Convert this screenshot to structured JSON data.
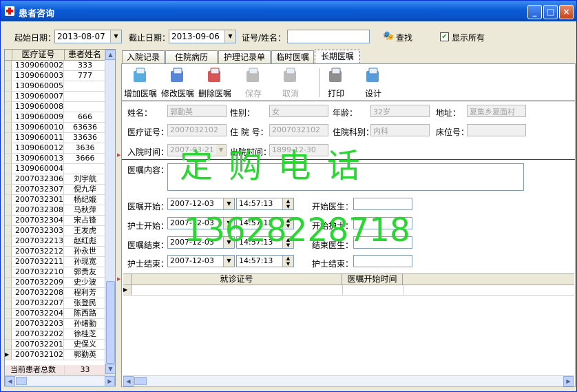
{
  "window": {
    "title": "患者咨询",
    "minimize": "_",
    "maximize": "□",
    "close": "×"
  },
  "filter": {
    "start_label": "起始日期：",
    "start_value": "2013-08-07",
    "end_label": "截止日期：",
    "end_value": "2013-09-06",
    "id_label": "证号/姓名：",
    "id_value": "",
    "search_label": "查找",
    "show_all_label": "显示所有",
    "show_all_checked": true
  },
  "patient_list": {
    "columns": [
      "医疗证号",
      "患者姓名"
    ],
    "rows": [
      {
        "id": "1309060002",
        "name": "333"
      },
      {
        "id": "1309060003",
        "name": "777"
      },
      {
        "id": "1309060005",
        "name": ""
      },
      {
        "id": "1309060007",
        "name": ""
      },
      {
        "id": "1309060008",
        "name": ""
      },
      {
        "id": "1309060009",
        "name": "666"
      },
      {
        "id": "1309060010",
        "name": "63636"
      },
      {
        "id": "1309060011",
        "name": "33636"
      },
      {
        "id": "1309060012",
        "name": "3636"
      },
      {
        "id": "1309060013",
        "name": "3666"
      },
      {
        "id": "1309060004",
        "name": ""
      },
      {
        "id": "2007032306",
        "name": "刘宇航"
      },
      {
        "id": "2007032307",
        "name": "倪九华"
      },
      {
        "id": "2007032301",
        "name": "杨纪娥"
      },
      {
        "id": "2007032308",
        "name": "马秋萍"
      },
      {
        "id": "2007032304",
        "name": "宋占锋"
      },
      {
        "id": "2007032303",
        "name": "王发虎"
      },
      {
        "id": "2007032213",
        "name": "赵红彪"
      },
      {
        "id": "2007032212",
        "name": "孙永世"
      },
      {
        "id": "2007032211",
        "name": "孙现宽"
      },
      {
        "id": "2007032210",
        "name": "郭贵友"
      },
      {
        "id": "2007032209",
        "name": "史少波"
      },
      {
        "id": "2007032208",
        "name": "程利芳"
      },
      {
        "id": "2007032207",
        "name": "张登民"
      },
      {
        "id": "2007032204",
        "name": "陈西路"
      },
      {
        "id": "2007032203",
        "name": "孙绪勤"
      },
      {
        "id": "2007032202",
        "name": "徐桂芝"
      },
      {
        "id": "2007032201",
        "name": "史保义"
      },
      {
        "id": "2007032102",
        "name": "郭勤英"
      }
    ],
    "selected_index": 28,
    "total_label": "当前患者总数",
    "total_value": "33"
  },
  "tabs": [
    "入院记录",
    "住院病历",
    "护理记录单",
    "临时医嘱",
    "长期医嘱"
  ],
  "active_tab": 4,
  "tools": [
    {
      "label": "增加医嘱",
      "icon": "add-order-icon",
      "enabled": true
    },
    {
      "label": "修改医嘱",
      "icon": "edit-order-icon",
      "enabled": true
    },
    {
      "label": "删除医嘱",
      "icon": "delete-order-icon",
      "enabled": true
    },
    {
      "label": "保存",
      "icon": "save-icon",
      "enabled": false
    },
    {
      "label": "取消",
      "icon": "cancel-icon",
      "enabled": false
    },
    {
      "label": "打印",
      "icon": "printer-icon",
      "enabled": true
    },
    {
      "label": "设计",
      "icon": "design-icon",
      "enabled": true
    }
  ],
  "patient_info": {
    "name_label": "姓名：",
    "name_value": "郭勤英",
    "sex_label": "性别：",
    "sex_value": "女",
    "age_label": "年龄：",
    "age_value": "32岁",
    "address_label": "地址：",
    "address_value": "夏集乡夏面村",
    "med_id_label": "医疗证号：",
    "med_id_value": "2007032102",
    "hosp_no_label": "住 院 号：",
    "hosp_no_value": "2007032102",
    "dept_label": "住院科别：",
    "dept_value": "内科",
    "bed_label": "床位号：",
    "bed_value": "",
    "admit_label": "入院时间：",
    "admit_value": "2007-03-21",
    "discharge_label": "出院时间：",
    "discharge_value": "1899-12-30"
  },
  "order": {
    "content_label": "医嘱内容：",
    "content_value": "",
    "start_label": "医嘱开始：",
    "start_date": "2007-12-03",
    "start_time": "14:57:13",
    "start_doctor_label": "开始医生：",
    "nurse_start_label": "护士开始：",
    "nurse_start_date": "2007-12-03",
    "nurse_start_time": "14:57:13",
    "start_nurse_label": "开始护士：",
    "end_label": "医嘱结束：",
    "end_date": "2007-12-03",
    "end_time": "14:57:13",
    "end_doctor_label": "结束医生：",
    "nurse_end_label": "护士结束：",
    "nurse_end_date": "2007-12-03",
    "nurse_end_time": "14:57:13",
    "end_nurse_label": "护士结束："
  },
  "order_grid": {
    "columns": [
      "就诊证号",
      "医嘱开始时间"
    ]
  },
  "watermark": {
    "line1": "定 购 电 话",
    "line2": "13628228718",
    "color": "#2ad631"
  },
  "colors": {
    "titlebar": "#0a5bd6",
    "window_bg": "#ece9d8",
    "selected_row_total": "#f5e6e6"
  }
}
